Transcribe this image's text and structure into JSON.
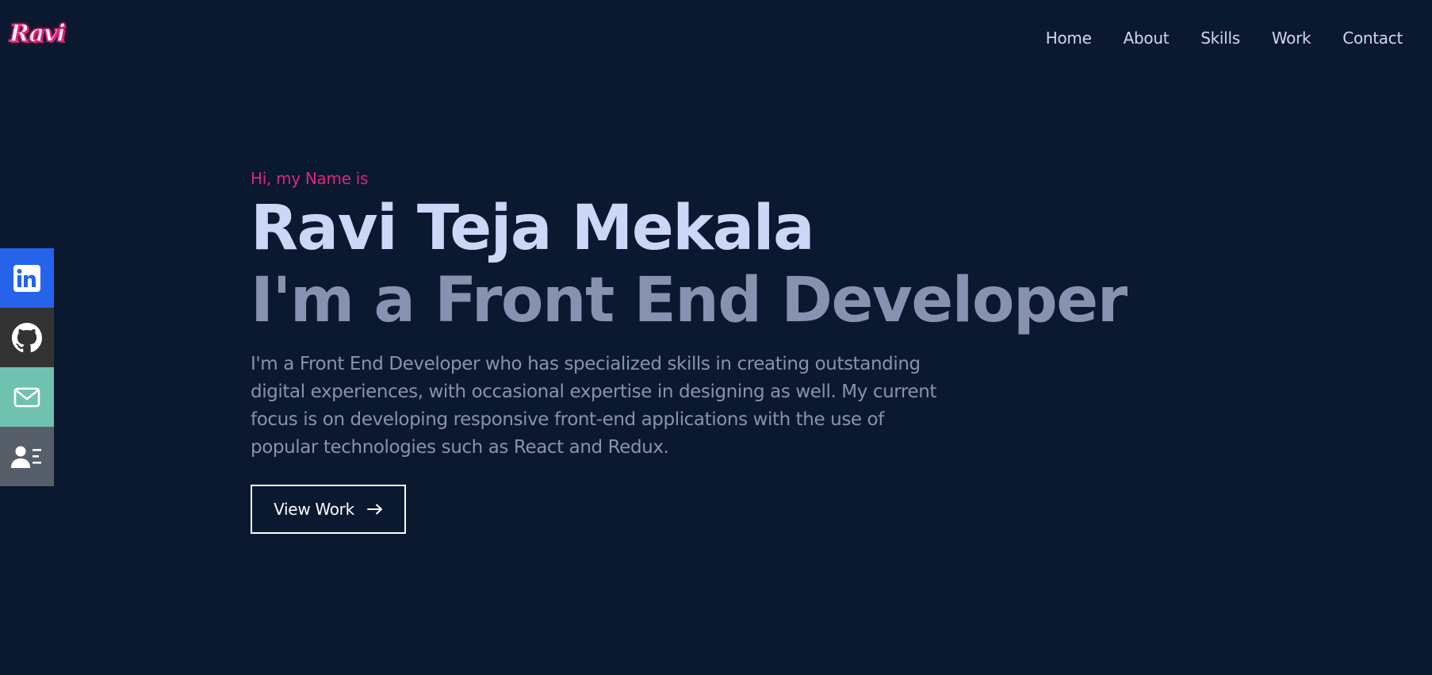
{
  "logo": {
    "text": "Ravi"
  },
  "nav": {
    "items": [
      {
        "label": "Home"
      },
      {
        "label": "About"
      },
      {
        "label": "Skills"
      },
      {
        "label": "Work"
      },
      {
        "label": "Contact"
      }
    ]
  },
  "social": {
    "items": [
      {
        "icon": "linkedin-icon",
        "color": "#2563eb"
      },
      {
        "icon": "github-icon",
        "color": "#333333"
      },
      {
        "icon": "mail-icon",
        "color": "#6fc2b0"
      },
      {
        "icon": "contact-card-icon",
        "color": "#565f69"
      }
    ]
  },
  "hero": {
    "greeting": "Hi, my Name is",
    "name": "Ravi Teja Mekala",
    "role": "I'm a Front End Developer",
    "bio": "I'm a Front End Developer who has specialized skills in creating outstanding digital experiences, with occasional expertise in designing as well. My current focus is on developing responsive front-end applications with the use of popular technologies such as React and Redux.",
    "cta_label": "View Work",
    "cta_icon": "arrow-right-icon"
  },
  "colors": {
    "background": "#0a192f",
    "accent": "#db2777",
    "heading": "#ccd6f6",
    "muted": "#8892b0"
  }
}
